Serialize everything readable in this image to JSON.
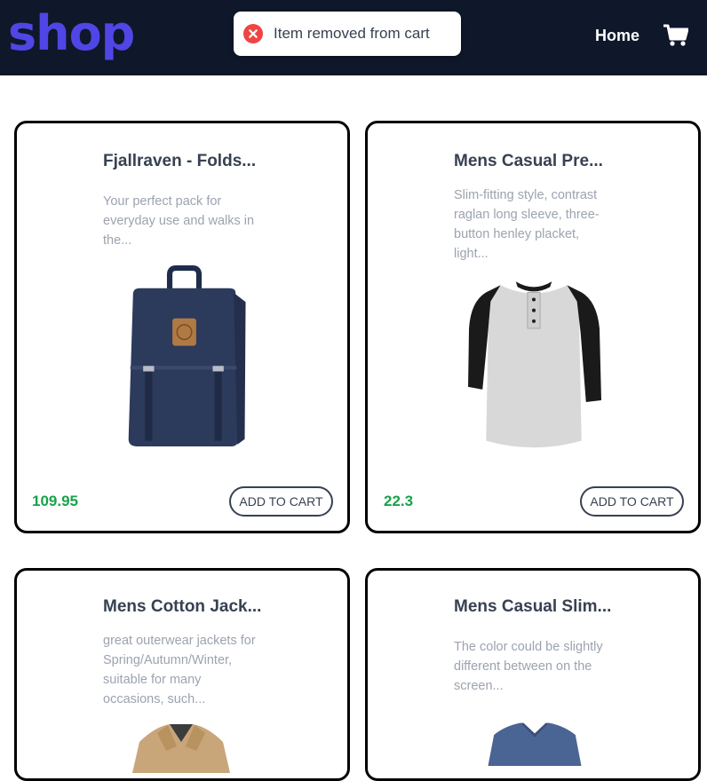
{
  "header": {
    "logo": "shop",
    "nav_home": "Home",
    "toast_message": "Item removed from cart"
  },
  "colors": {
    "navbar_bg": "#0f172a",
    "logo": "#4f46e5",
    "price": "#16a34a",
    "toast_error": "#ef4444"
  },
  "products": [
    {
      "title": "Fjallraven - Folds...",
      "description": "Your perfect pack for everyday use and walks in the...",
      "price": "109.95",
      "button": "ADD TO CART",
      "image": "backpack"
    },
    {
      "title": "Mens Casual Pre...",
      "description": "Slim-fitting style, contrast raglan long sleeve, three-button henley placket, light...",
      "price": "22.3",
      "button": "ADD TO CART",
      "image": "raglan-shirt"
    },
    {
      "title": "Mens Cotton Jack...",
      "description": "great outerwear jackets for Spring/Autumn/Winter, suitable for many occasions, such...",
      "image": "jacket"
    },
    {
      "title": "Mens Casual Slim...",
      "description": "The color could be slightly different between on the screen...",
      "image": "vneck-shirt"
    }
  ]
}
